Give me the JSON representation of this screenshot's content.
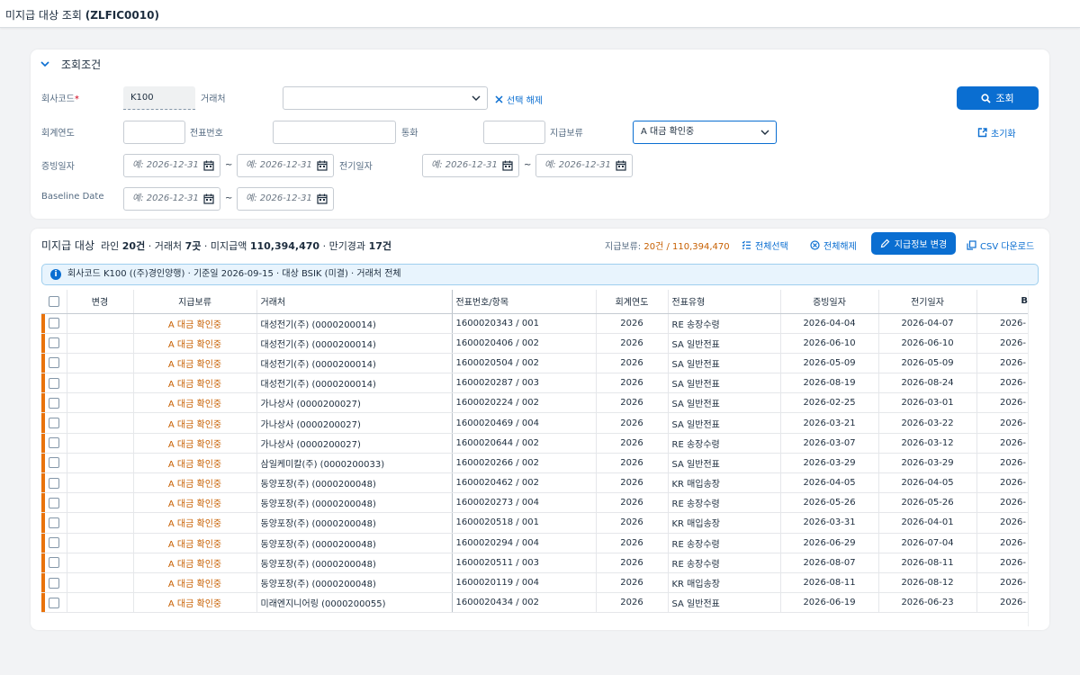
{
  "app": {
    "title": "미지급 대상 조회",
    "code": "(ZLFIC0010)"
  },
  "filters": {
    "header": "조회조건",
    "company_code": {
      "label": "회사코드",
      "value": "K100"
    },
    "vendor": {
      "label": "거래처",
      "value": ""
    },
    "clear_selection": "선택 해제",
    "search_button": "조회",
    "reset_button": "초기화",
    "fiscal_year": {
      "label": "회계연도",
      "value": ""
    },
    "doc_no": {
      "label": "전표번호",
      "value": ""
    },
    "currency": {
      "label": "통화",
      "value": ""
    },
    "payment_block": {
      "label": "지급보류",
      "value": "A 대금 확인중"
    },
    "doc_date": {
      "label": "증빙일자",
      "from_placeholder": "예: 2026-12-31",
      "to_placeholder": "예: 2026-12-31"
    },
    "posting_date": {
      "label": "전기일자",
      "from_placeholder": "예: 2026-12-31",
      "to_placeholder": "예: 2026-12-31"
    },
    "baseline_date": {
      "label": "Baseline Date",
      "from_placeholder": "예: 2026-12-31",
      "to_placeholder": "예: 2026-12-31"
    },
    "range_sep": "~"
  },
  "results": {
    "title": "미지급 대상",
    "lines_label": "라인",
    "lines_count": "20건",
    "vendors_label": "· 거래처",
    "vendors_count": "7곳",
    "amount_label": "· 미지급액",
    "amount": "110,394,470",
    "overdue_label": "· 만기경과",
    "overdue_count": "17건",
    "hold_summary_label": "지급보류:",
    "hold_summary_value": "20건 / 110,394,470",
    "select_all": "전체선택",
    "deselect_all": "전체해제",
    "change_payment": "지급정보 변경",
    "csv_download": "CSV 다운로드",
    "info_text": "회사코드 K100 ((주)경인양행) · 기준일 2026-09-15 · 대상 BSIK (미결) · 거래처 전체",
    "columns": [
      "변경",
      "지급보류",
      "거래처",
      "전표번호/항목",
      "회계연도",
      "전표유형",
      "증빙일자",
      "전기일자",
      "Base"
    ],
    "rows": [
      {
        "hold": "A 대금 확인중",
        "vendor": "대성전기(주) (0000200014)",
        "doc": "1600020343 / 001",
        "year": "2026",
        "type": "RE 송장수령",
        "doc_date": "2026-04-04",
        "post_date": "2026-04-07",
        "base": "2026-"
      },
      {
        "hold": "A 대금 확인중",
        "vendor": "대성전기(주) (0000200014)",
        "doc": "1600020406 / 002",
        "year": "2026",
        "type": "SA 일반전표",
        "doc_date": "2026-06-10",
        "post_date": "2026-06-10",
        "base": "2026-"
      },
      {
        "hold": "A 대금 확인중",
        "vendor": "대성전기(주) (0000200014)",
        "doc": "1600020504 / 002",
        "year": "2026",
        "type": "SA 일반전표",
        "doc_date": "2026-05-09",
        "post_date": "2026-05-09",
        "base": "2026-"
      },
      {
        "hold": "A 대금 확인중",
        "vendor": "대성전기(주) (0000200014)",
        "doc": "1600020287 / 003",
        "year": "2026",
        "type": "SA 일반전표",
        "doc_date": "2026-08-19",
        "post_date": "2026-08-24",
        "base": "2026-"
      },
      {
        "hold": "A 대금 확인중",
        "vendor": "가나상사 (0000200027)",
        "doc": "1600020224 / 002",
        "year": "2026",
        "type": "SA 일반전표",
        "doc_date": "2026-02-25",
        "post_date": "2026-03-01",
        "base": "2026-"
      },
      {
        "hold": "A 대금 확인중",
        "vendor": "가나상사 (0000200027)",
        "doc": "1600020469 / 004",
        "year": "2026",
        "type": "SA 일반전표",
        "doc_date": "2026-03-21",
        "post_date": "2026-03-22",
        "base": "2026-"
      },
      {
        "hold": "A 대금 확인중",
        "vendor": "가나상사 (0000200027)",
        "doc": "1600020644 / 002",
        "year": "2026",
        "type": "RE 송장수령",
        "doc_date": "2026-03-07",
        "post_date": "2026-03-12",
        "base": "2026-"
      },
      {
        "hold": "A 대금 확인중",
        "vendor": "삼일케미칼(주) (0000200033)",
        "doc": "1600020266 / 002",
        "year": "2026",
        "type": "SA 일반전표",
        "doc_date": "2026-03-29",
        "post_date": "2026-03-29",
        "base": "2026-"
      },
      {
        "hold": "A 대금 확인중",
        "vendor": "동양포장(주) (0000200048)",
        "doc": "1600020462 / 002",
        "year": "2026",
        "type": "KR 매입송장",
        "doc_date": "2026-04-05",
        "post_date": "2026-04-05",
        "base": "2026-"
      },
      {
        "hold": "A 대금 확인중",
        "vendor": "동양포장(주) (0000200048)",
        "doc": "1600020273 / 004",
        "year": "2026",
        "type": "RE 송장수령",
        "doc_date": "2026-05-26",
        "post_date": "2026-05-26",
        "base": "2026-"
      },
      {
        "hold": "A 대금 확인중",
        "vendor": "동양포장(주) (0000200048)",
        "doc": "1600020518 / 001",
        "year": "2026",
        "type": "KR 매입송장",
        "doc_date": "2026-03-31",
        "post_date": "2026-04-01",
        "base": "2026-"
      },
      {
        "hold": "A 대금 확인중",
        "vendor": "동양포장(주) (0000200048)",
        "doc": "1600020294 / 004",
        "year": "2026",
        "type": "RE 송장수령",
        "doc_date": "2026-06-29",
        "post_date": "2026-07-04",
        "base": "2026-"
      },
      {
        "hold": "A 대금 확인중",
        "vendor": "동양포장(주) (0000200048)",
        "doc": "1600020511 / 003",
        "year": "2026",
        "type": "RE 송장수령",
        "doc_date": "2026-08-07",
        "post_date": "2026-08-11",
        "base": "2026-"
      },
      {
        "hold": "A 대금 확인중",
        "vendor": "동양포장(주) (0000200048)",
        "doc": "1600020119 / 004",
        "year": "2026",
        "type": "KR 매입송장",
        "doc_date": "2026-08-11",
        "post_date": "2026-08-12",
        "base": "2026-"
      },
      {
        "hold": "A 대금 확인중",
        "vendor": "미래엔지니어링 (0000200055)",
        "doc": "1600020434 / 002",
        "year": "2026",
        "type": "SA 일반전표",
        "doc_date": "2026-06-19",
        "post_date": "2026-06-23",
        "base": "2026-"
      }
    ]
  },
  "colors": {
    "accent": "#0a6ed1",
    "hold_text": "#c75f00",
    "row_marker": "#e9730c"
  }
}
